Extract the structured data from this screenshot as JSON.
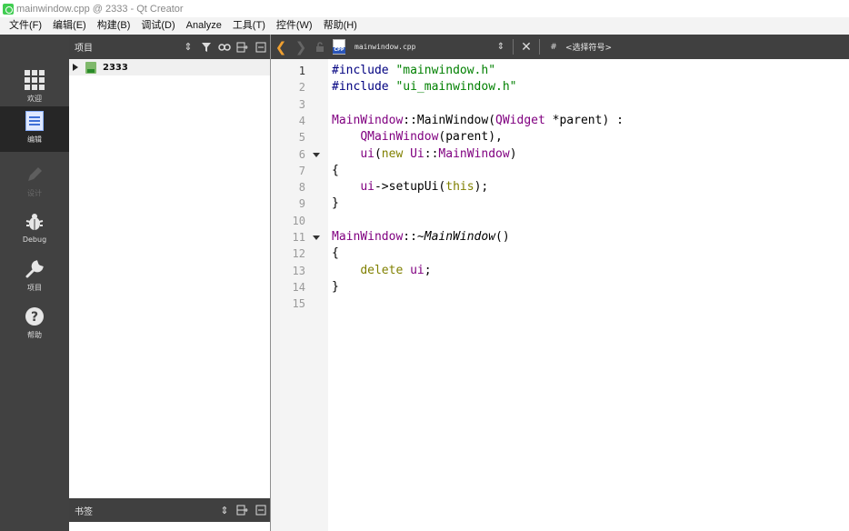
{
  "window": {
    "title": "mainwindow.cpp @ 2333 - Qt Creator"
  },
  "menubar": {
    "items": [
      "文件(F)",
      "编辑(E)",
      "构建(B)",
      "调试(D)",
      "Analyze",
      "工具(T)",
      "控件(W)",
      "帮助(H)"
    ]
  },
  "modes": [
    {
      "label": "欢迎",
      "icon": "welcome-grid-icon",
      "active": false,
      "enabled": true
    },
    {
      "label": "编辑",
      "icon": "edit-document-icon",
      "active": true,
      "enabled": true
    },
    {
      "label": "设计",
      "icon": "design-pencil-icon",
      "active": false,
      "enabled": false
    },
    {
      "label": "Debug",
      "icon": "debug-bug-icon",
      "active": false,
      "enabled": true
    },
    {
      "label": "项目",
      "icon": "projects-wrench-icon",
      "active": false,
      "enabled": true
    },
    {
      "label": "帮助",
      "icon": "help-question-icon",
      "active": false,
      "enabled": true
    }
  ],
  "project_pane": {
    "title": "项目",
    "tree": [
      {
        "name": "2333",
        "expanded": false
      }
    ]
  },
  "bookmarks_pane": {
    "title": "书签"
  },
  "editor": {
    "file_name": "mainwindow.cpp",
    "symbol_placeholder": "<选择符号>",
    "hash_label": "#",
    "current_line": 1,
    "lines": [
      {
        "num": "1",
        "fold": false,
        "tokens": [
          {
            "t": "#include ",
            "c": "pre"
          },
          {
            "t": "\"mainwindow.h\"",
            "c": "str"
          }
        ]
      },
      {
        "num": "2",
        "fold": false,
        "tokens": [
          {
            "t": "#include ",
            "c": "pre"
          },
          {
            "t": "\"ui_mainwindow.h\"",
            "c": "str"
          }
        ]
      },
      {
        "num": "3",
        "fold": false,
        "tokens": []
      },
      {
        "num": "4",
        "fold": false,
        "tokens": [
          {
            "t": "MainWindow",
            "c": "type"
          },
          {
            "t": "::MainWindow(",
            "c": "plain"
          },
          {
            "t": "QWidget",
            "c": "type"
          },
          {
            "t": " *parent) :",
            "c": "plain"
          }
        ]
      },
      {
        "num": "5",
        "fold": false,
        "tokens": [
          {
            "t": "    ",
            "c": "plain"
          },
          {
            "t": "QMainWindow",
            "c": "type"
          },
          {
            "t": "(parent),",
            "c": "plain"
          }
        ]
      },
      {
        "num": "6",
        "fold": true,
        "tokens": [
          {
            "t": "    ",
            "c": "plain"
          },
          {
            "t": "ui",
            "c": "type"
          },
          {
            "t": "(",
            "c": "plain"
          },
          {
            "t": "new",
            "c": "kw"
          },
          {
            "t": " ",
            "c": "plain"
          },
          {
            "t": "Ui",
            "c": "type"
          },
          {
            "t": "::",
            "c": "plain"
          },
          {
            "t": "MainWindow",
            "c": "type"
          },
          {
            "t": ")",
            "c": "plain"
          }
        ]
      },
      {
        "num": "7",
        "fold": false,
        "tokens": [
          {
            "t": "{",
            "c": "plain"
          }
        ]
      },
      {
        "num": "8",
        "fold": false,
        "tokens": [
          {
            "t": "    ",
            "c": "plain"
          },
          {
            "t": "ui",
            "c": "type"
          },
          {
            "t": "->setupUi(",
            "c": "plain"
          },
          {
            "t": "this",
            "c": "kw"
          },
          {
            "t": ");",
            "c": "plain"
          }
        ]
      },
      {
        "num": "9",
        "fold": false,
        "tokens": [
          {
            "t": "}",
            "c": "plain"
          }
        ]
      },
      {
        "num": "10",
        "fold": false,
        "tokens": []
      },
      {
        "num": "11",
        "fold": true,
        "tokens": [
          {
            "t": "MainWindow",
            "c": "type"
          },
          {
            "t": "::~",
            "c": "plain"
          },
          {
            "t": "MainWindow",
            "c": "italic"
          },
          {
            "t": "()",
            "c": "plain"
          }
        ]
      },
      {
        "num": "12",
        "fold": false,
        "tokens": [
          {
            "t": "{",
            "c": "plain"
          }
        ]
      },
      {
        "num": "13",
        "fold": false,
        "tokens": [
          {
            "t": "    ",
            "c": "plain"
          },
          {
            "t": "delete",
            "c": "kw"
          },
          {
            "t": " ",
            "c": "plain"
          },
          {
            "t": "ui",
            "c": "type"
          },
          {
            "t": ";",
            "c": "plain"
          }
        ]
      },
      {
        "num": "14",
        "fold": false,
        "tokens": [
          {
            "t": "}",
            "c": "plain"
          }
        ]
      },
      {
        "num": "15",
        "fold": false,
        "tokens": []
      }
    ]
  },
  "colors": {
    "sidebar_bg": "#414141",
    "toolbar_bg": "#404040",
    "preprocessor": "#000080",
    "string": "#008000",
    "type": "#800080",
    "keyword": "#808000"
  }
}
